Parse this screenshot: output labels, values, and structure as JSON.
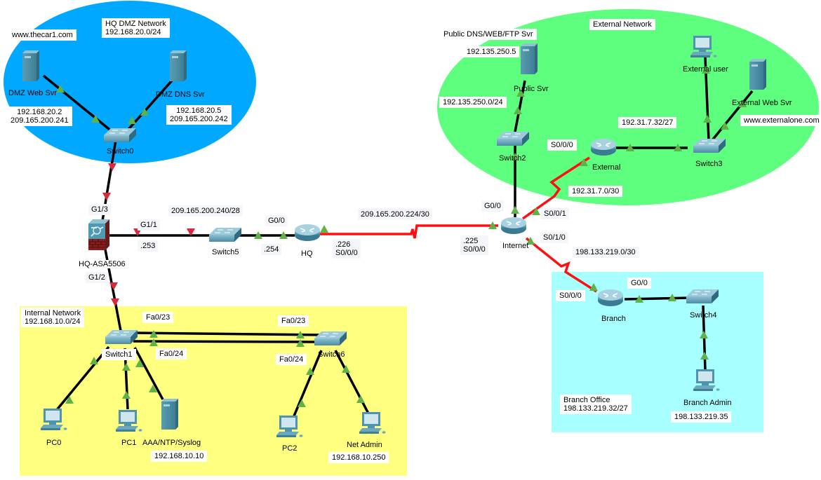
{
  "colors": {
    "dmz_zone": "#00a8ff",
    "external_zone": "#5eff7f",
    "internal_zone": "#ffff80",
    "branch_zone": "#a8ffff",
    "ethernet_link": "#000000",
    "serial_link": "#ff1010",
    "link_up": "#5fb346",
    "link_down": "#d8283a"
  },
  "zones": {
    "dmz": {
      "title": "HQ DMZ Network\n192.168.20.0/24"
    },
    "external": {
      "title": "External Network"
    },
    "internal": {
      "title": "Internal Network\n192.168.10.0/24"
    },
    "branch": {
      "title": "Branch Office\n198.133.219.32/27"
    }
  },
  "devices": [
    {
      "id": "dmz-web-svr",
      "type": "server",
      "label": "DMZ Web Svr"
    },
    {
      "id": "dmz-dns-svr",
      "type": "server",
      "label": "DMZ DNS Svr"
    },
    {
      "id": "switch0",
      "type": "switch",
      "label": "Switch0"
    },
    {
      "id": "hq-asa",
      "type": "firewall",
      "label": "HQ-ASA5506"
    },
    {
      "id": "switch5",
      "type": "switch",
      "label": "Switch5"
    },
    {
      "id": "hq",
      "type": "router",
      "label": "HQ"
    },
    {
      "id": "internet",
      "type": "router",
      "label": "Internet"
    },
    {
      "id": "switch2",
      "type": "switch",
      "label": "Switch2"
    },
    {
      "id": "public-svr",
      "type": "server",
      "label": "Public Svr"
    },
    {
      "id": "external",
      "type": "router",
      "label": "External"
    },
    {
      "id": "switch3",
      "type": "switch",
      "label": "Switch3"
    },
    {
      "id": "external-user",
      "type": "pc",
      "label": "External user"
    },
    {
      "id": "external-web-svr",
      "type": "server",
      "label": "External Web Svr"
    },
    {
      "id": "branch",
      "type": "router",
      "label": "Branch"
    },
    {
      "id": "switch4",
      "type": "switch",
      "label": "Switch4"
    },
    {
      "id": "branch-admin",
      "type": "pc",
      "label": "Branch Admin"
    },
    {
      "id": "switch1",
      "type": "switch",
      "label": "Switch1"
    },
    {
      "id": "switch6",
      "type": "switch",
      "label": "Switch6"
    },
    {
      "id": "pc0",
      "type": "pc",
      "label": "PC0"
    },
    {
      "id": "pc1",
      "type": "pc",
      "label": "PC1"
    },
    {
      "id": "aaa-svr",
      "type": "server",
      "label": "AAA/NTP/Syslog"
    },
    {
      "id": "pc2",
      "type": "pc",
      "label": "PC2"
    },
    {
      "id": "net-admin",
      "type": "pc",
      "label": "Net Admin"
    }
  ],
  "links": [
    {
      "from": "dmz-web-svr",
      "to": "switch0",
      "kind": "ethernet",
      "status": [
        "up",
        "up"
      ]
    },
    {
      "from": "dmz-dns-svr",
      "to": "switch0",
      "kind": "ethernet",
      "status": [
        "up",
        "up"
      ]
    },
    {
      "from": "switch0",
      "to": "hq-asa",
      "kind": "ethernet",
      "status": [
        "down",
        "down"
      ]
    },
    {
      "from": "hq-asa",
      "to": "switch5",
      "kind": "ethernet",
      "status": [
        "down",
        "down"
      ]
    },
    {
      "from": "switch5",
      "to": "hq",
      "kind": "ethernet",
      "status": [
        "up",
        "up"
      ]
    },
    {
      "from": "hq",
      "to": "internet",
      "kind": "serial",
      "status": [
        "up",
        "up"
      ]
    },
    {
      "from": "internet",
      "to": "switch2",
      "kind": "ethernet",
      "status": [
        "up",
        "up"
      ]
    },
    {
      "from": "switch2",
      "to": "public-svr",
      "kind": "ethernet",
      "status": [
        "up",
        "up"
      ]
    },
    {
      "from": "internet",
      "to": "external",
      "kind": "serial",
      "status": [
        "up",
        "up"
      ]
    },
    {
      "from": "external",
      "to": "switch3",
      "kind": "ethernet",
      "status": [
        "up",
        "up"
      ]
    },
    {
      "from": "switch3",
      "to": "external-user",
      "kind": "ethernet",
      "status": [
        "up",
        "up"
      ]
    },
    {
      "from": "switch3",
      "to": "external-web-svr",
      "kind": "ethernet",
      "status": [
        "up",
        "up"
      ]
    },
    {
      "from": "internet",
      "to": "branch",
      "kind": "serial",
      "status": [
        "up",
        "up"
      ]
    },
    {
      "from": "branch",
      "to": "switch4",
      "kind": "ethernet",
      "status": [
        "up",
        "up"
      ]
    },
    {
      "from": "switch4",
      "to": "branch-admin",
      "kind": "ethernet",
      "status": [
        "up",
        "up"
      ]
    },
    {
      "from": "hq-asa",
      "to": "switch1",
      "kind": "ethernet",
      "status": [
        "down",
        "down"
      ]
    },
    {
      "from": "switch1",
      "to": "switch6",
      "kind": "ethernet",
      "status": [
        "up",
        "up"
      ]
    },
    {
      "from": "switch1",
      "to": "switch6",
      "kind": "ethernet",
      "status": [
        "up",
        "up"
      ]
    },
    {
      "from": "switch1",
      "to": "pc0",
      "kind": "ethernet",
      "status": [
        "up",
        "up"
      ]
    },
    {
      "from": "switch1",
      "to": "pc1",
      "kind": "ethernet",
      "status": [
        "up",
        "up"
      ]
    },
    {
      "from": "switch1",
      "to": "aaa-svr",
      "kind": "ethernet",
      "status": [
        "up",
        "up"
      ]
    },
    {
      "from": "switch6",
      "to": "pc2",
      "kind": "ethernet",
      "status": [
        "up",
        "up"
      ]
    },
    {
      "from": "switch6",
      "to": "net-admin",
      "kind": "ethernet",
      "status": [
        "up",
        "up"
      ]
    }
  ],
  "annotations": {
    "dmz_web_url": "www.thecar1.com",
    "dmz_web_ips": "192.168.20.2\n209.165.200.241",
    "dmz_dns_ips": "192.168.20.5\n209.165.200.242",
    "asa_g13": "G1/3",
    "asa_g11": "G1/1",
    "asa_g11_ip": ".253",
    "asa_g12": "G1/2",
    "outside_net": "209.165.200.240/28",
    "hq_g00": "G0/0",
    "hq_g00_ip": ".254",
    "hq_s000": ".226\nS0/0/0",
    "hq_internet_net": "209.165.200.224/30",
    "internet_s000": ".225\nS0/0/0",
    "internet_g00": "G0/0",
    "internet_s001": "S0/0/1",
    "internet_s010": "S0/1/0",
    "public_svr_title": "Public DNS/WEB/FTP Svr",
    "public_svr_ip": "192.135.250.5",
    "public_net": "192.135.250.0/24",
    "external_s000": "S0/0/0",
    "external_lan_net": "192.31.7.32/27",
    "external_wan_net": "192.31.7.0/30",
    "external_web_url": "www.externalone.com",
    "branch_wan_net": "198.133.219.0/30",
    "branch_s000": "S0/0/0",
    "branch_g00": "G0/0",
    "branch_admin_ip": "198.133.219.35",
    "sw1_fa023": "Fa0/23",
    "sw1_fa024": "Fa0/24",
    "sw6_fa023": "Fa0/23",
    "sw6_fa024": "Fa0/24",
    "aaa_ip": "192.168.10.10",
    "net_admin_ip": "192.168.10.250"
  }
}
